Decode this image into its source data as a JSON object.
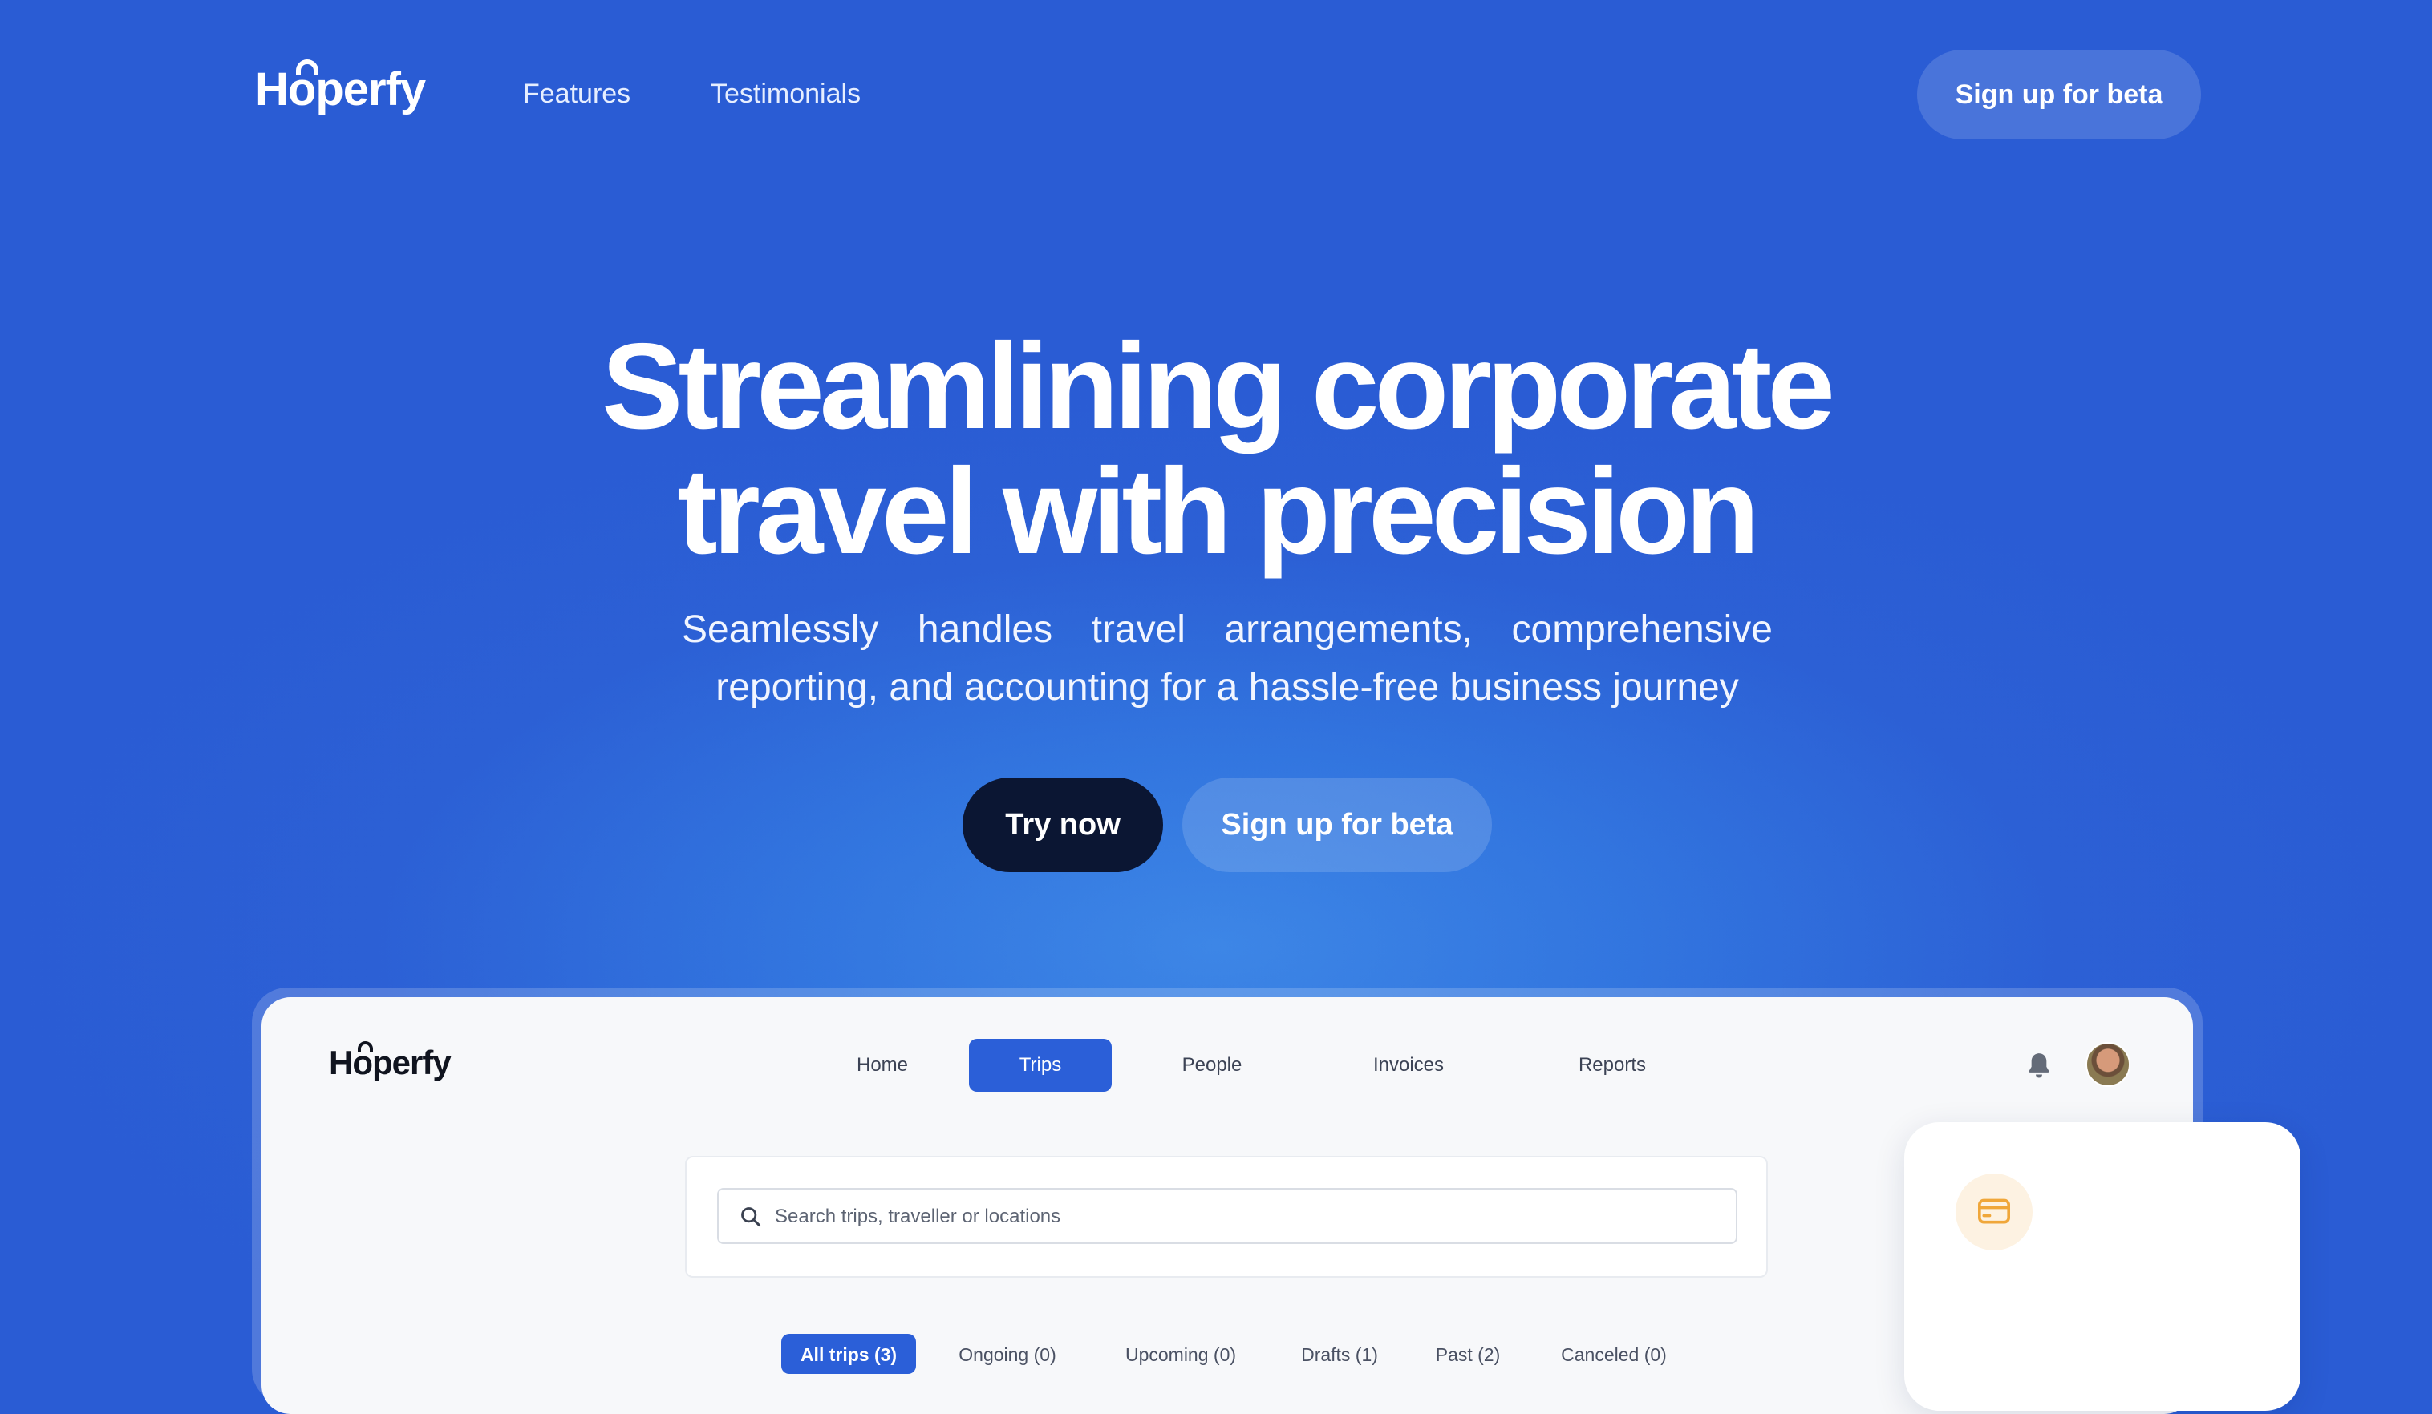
{
  "nav": {
    "logo_prefix": "H",
    "logo_o": "o",
    "logo_suffix": "perfy",
    "links": [
      "Features",
      "Testimonials"
    ],
    "cta": "Sign up for beta"
  },
  "hero": {
    "title_line1": "Streamlining corporate",
    "title_line2": "travel with precision",
    "subtitle": "Seamlessly handles travel arrangements, comprehensive reporting, and accounting for a hassle-free business journey",
    "primary_cta": "Try now",
    "secondary_cta": "Sign up for beta"
  },
  "app_preview": {
    "logo_prefix": "H",
    "logo_o": "o",
    "logo_suffix": "perfy",
    "tabs": [
      "Home",
      "Trips",
      "People",
      "Invoices",
      "Reports"
    ],
    "active_tab": "Trips",
    "icons": [
      "bell-icon",
      "avatar"
    ],
    "search": {
      "placeholder": "Search trips, traveller or locations",
      "value": ""
    },
    "filters": [
      "All trips (3)",
      "Ongoing (0)",
      "Upcoming (0)",
      "Drafts (1)",
      "Past (2)",
      "Canceled (0)"
    ],
    "active_filter": "All trips (3)"
  },
  "side_card": {
    "icon": "credit-card-icon"
  },
  "colors": {
    "brand_blue": "#2b5fd8",
    "background_blue": "#2a5cd4",
    "dark_button": "#0b1633",
    "card_icon_accent": "#f0a73a"
  }
}
